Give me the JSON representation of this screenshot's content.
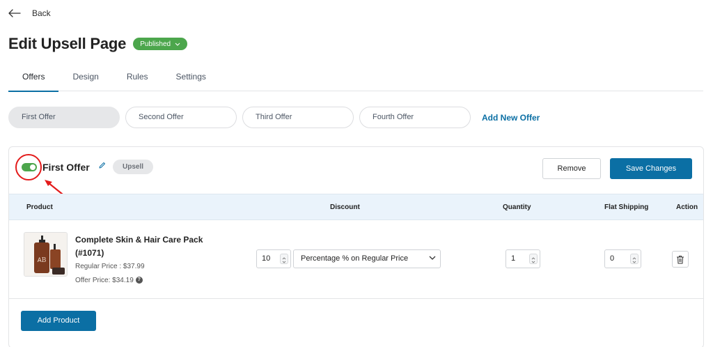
{
  "nav": {
    "back_label": "Back"
  },
  "header": {
    "title": "Edit Upsell Page",
    "status": "Published",
    "status_color": "#4ca64c"
  },
  "tabs": [
    {
      "label": "Offers",
      "active": true
    },
    {
      "label": "Design",
      "active": false
    },
    {
      "label": "Rules",
      "active": false
    },
    {
      "label": "Settings",
      "active": false
    }
  ],
  "offer_tabs": [
    {
      "label": "First Offer",
      "active": true
    },
    {
      "label": "Second Offer",
      "active": false
    },
    {
      "label": "Third Offer",
      "active": false
    },
    {
      "label": "Fourth Offer",
      "active": false
    }
  ],
  "add_offer_label": "Add New Offer",
  "offer": {
    "name": "First Offer",
    "enabled": true,
    "type_badge": "Upsell",
    "remove_label": "Remove",
    "save_label": "Save Changes"
  },
  "table": {
    "columns": {
      "product": "Product",
      "discount": "Discount",
      "quantity": "Quantity",
      "flat_shipping": "Flat Shipping",
      "action": "Action"
    },
    "rows": [
      {
        "product_name": "Complete Skin & Hair Care Pack (#1071)",
        "regular_price": "Regular Price : $37.99",
        "offer_price": "Offer Price: $34.19",
        "discount_value": "10",
        "discount_type": "Percentage % on Regular Price",
        "quantity": "1",
        "flat_shipping": "0"
      }
    ]
  },
  "add_product_label": "Add Product",
  "colors": {
    "accent": "#0b6fa4",
    "toggle_on": "#4ca64c",
    "annotation": "#e31b1b",
    "header_bg": "#eaf3fb"
  },
  "icons": {
    "back": "arrow-left-icon",
    "edit": "pencil-icon",
    "help": "question-icon",
    "delete": "trash-icon",
    "dropdown": "chevron-down-icon"
  }
}
